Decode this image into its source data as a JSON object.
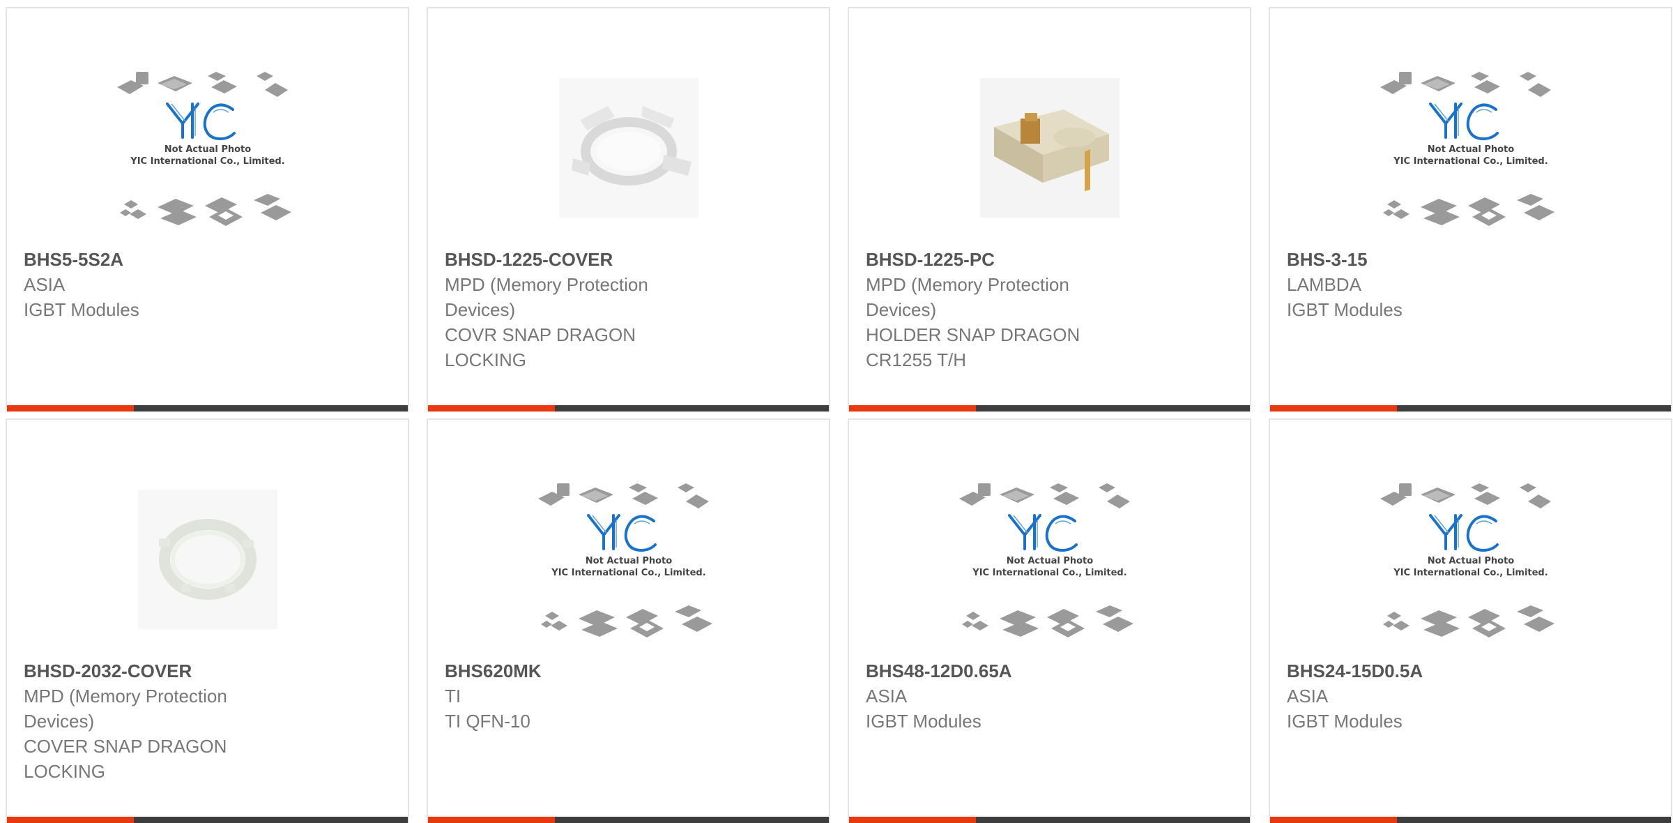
{
  "colors": {
    "accent": "#e8380d",
    "bar": "#3d3d3d",
    "logo": "#1a73c8"
  },
  "placeholder": {
    "line1": "Not Actual Photo",
    "line2": "YIC International Co., Limited.",
    "logo_text": "YIC"
  },
  "products": [
    {
      "part": "BHS5-5S2A",
      "lines": [
        "ASIA",
        "IGBT Modules"
      ],
      "image": "placeholder"
    },
    {
      "part": "BHSD-1225-COVER",
      "lines": [
        "MPD (Memory Protection",
        "Devices)",
        "COVR SNAP DRAGON",
        "LOCKING"
      ],
      "image": "clear-ring-cover"
    },
    {
      "part": "BHSD-1225-PC",
      "lines": [
        "MPD (Memory Protection",
        "Devices)",
        "HOLDER SNAP DRAGON",
        "CR1255 T/H"
      ],
      "image": "battery-holder"
    },
    {
      "part": "BHS-3-15",
      "lines": [
        "LAMBDA",
        "IGBT Modules"
      ],
      "image": "placeholder"
    },
    {
      "part": "BHSD-2032-COVER",
      "lines": [
        "MPD (Memory Protection",
        "Devices)",
        "COVER SNAP DRAGON",
        "LOCKING"
      ],
      "image": "clear-round-cover"
    },
    {
      "part": "BHS620MK",
      "lines": [
        "TI",
        "TI QFN-10"
      ],
      "image": "placeholder"
    },
    {
      "part": "BHS48-12D0.65A",
      "lines": [
        "ASIA",
        "IGBT Modules"
      ],
      "image": "placeholder"
    },
    {
      "part": "BHS24-15D0.5A",
      "lines": [
        "ASIA",
        "IGBT Modules"
      ],
      "image": "placeholder"
    }
  ]
}
